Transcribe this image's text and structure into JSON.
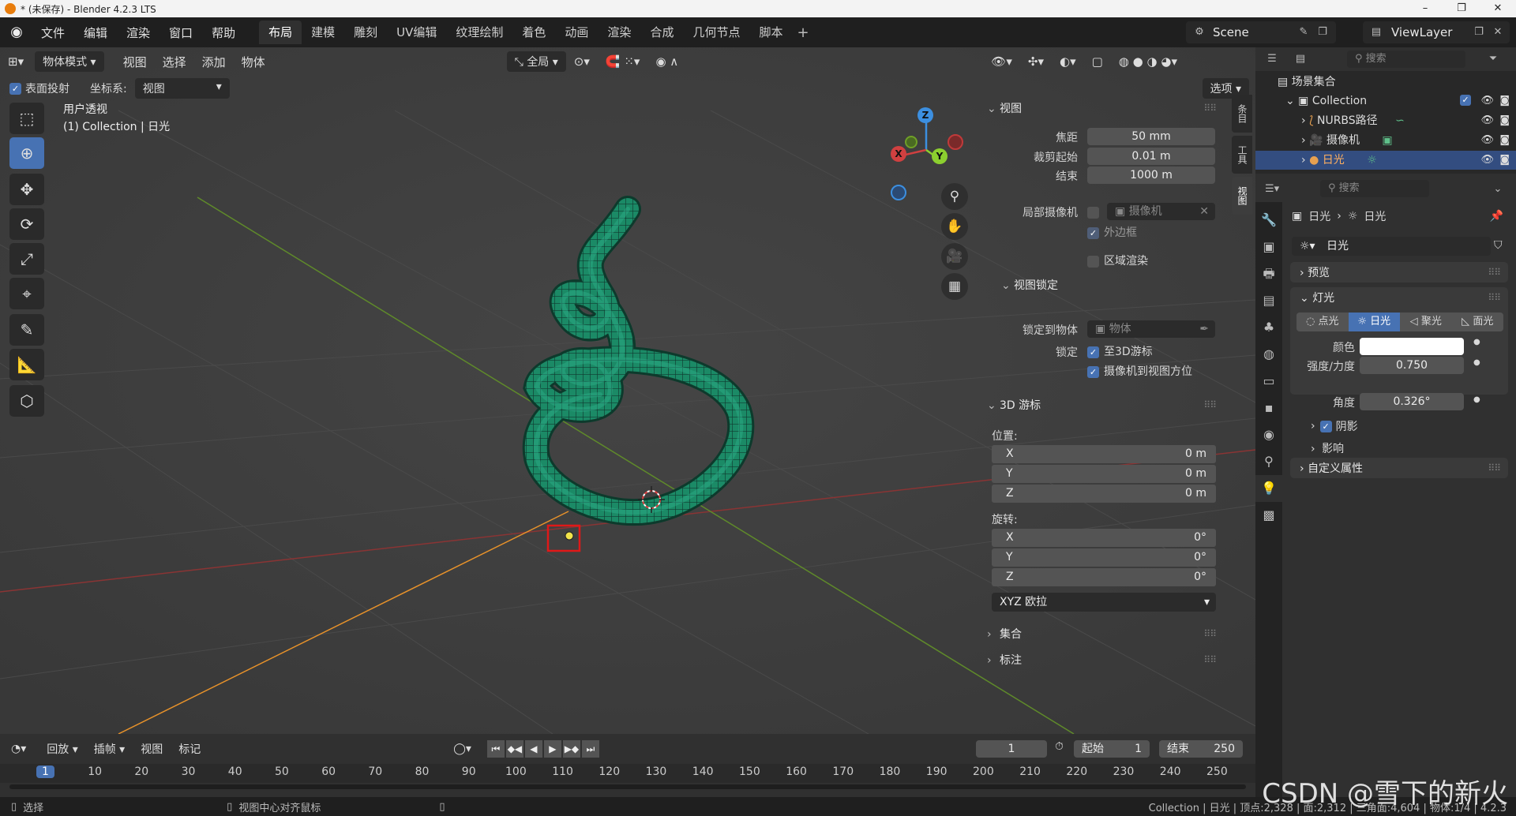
{
  "window": {
    "title": "* (未保存) - Blender 4.2.3 LTS",
    "min": "–",
    "max": "❐",
    "close": "✕"
  },
  "topbar": {
    "menus": [
      "文件",
      "编辑",
      "渲染",
      "窗口",
      "帮助"
    ],
    "tabs": [
      "布局",
      "建模",
      "雕刻",
      "UV编辑",
      "纹理绘制",
      "着色",
      "动画",
      "渲染",
      "合成",
      "几何节点",
      "脚本"
    ],
    "active_tab": 0,
    "scene": "Scene",
    "view_layer": "ViewLayer"
  },
  "viewport_header": {
    "mode": "物体模式",
    "menus": [
      "视图",
      "选择",
      "添加",
      "物体"
    ],
    "transform_orientation": "全局",
    "options": "选项",
    "surface_project_label": "表面投射",
    "coord_label": "坐标系:",
    "coord_value": "视图"
  },
  "viewport_info": {
    "line1": "用户透视",
    "line2": "(1) Collection | 日光"
  },
  "gizmo": {
    "x": "X",
    "y": "Y",
    "z": "Z"
  },
  "npanel": {
    "tabs": [
      "条目",
      "工具",
      "视图"
    ],
    "view_section": "视图",
    "focal_label": "焦距",
    "focal_value": "50 mm",
    "clip_start_label": "裁剪起始",
    "clip_start_value": "0.01 m",
    "clip_end_label": "结束",
    "clip_end_value": "1000 m",
    "local_camera_label": "局部摄像机",
    "local_camera_value": "摄像机",
    "border_label": "外边框",
    "region_render_label": "区域渲染",
    "view_lock_section": "视图锁定",
    "lock_to_object_label": "锁定到物体",
    "lock_to_object_value": "物体",
    "lock_label": "锁定",
    "lock_to_cursor": "至3D游标",
    "lock_camera_to_view": "摄像机到视图方位",
    "cursor_section": "3D 游标",
    "location_label": "位置:",
    "loc": [
      {
        "axis": "X",
        "value": "0 m"
      },
      {
        "axis": "Y",
        "value": "0 m"
      },
      {
        "axis": "Z",
        "value": "0 m"
      }
    ],
    "rotation_label": "旋转:",
    "rot": [
      {
        "axis": "X",
        "value": "0°"
      },
      {
        "axis": "Y",
        "value": "0°"
      },
      {
        "axis": "Z",
        "value": "0°"
      }
    ],
    "rotation_mode": "XYZ 欧拉",
    "collections_section": "集合",
    "annotations_section": "标注"
  },
  "outliner": {
    "search_placeholder": "搜索",
    "scene_collection": "场景集合",
    "collection": "Collection",
    "items": [
      "NURBS路径",
      "摄像机",
      "日光"
    ]
  },
  "properties": {
    "search_placeholder": "搜索",
    "breadcrumb_obj": "日光",
    "breadcrumb_data": "日光",
    "datablock": "日光",
    "preview": "预览",
    "light_section": "灯光",
    "light_types": [
      "点光",
      "日光",
      "聚光",
      "面光"
    ],
    "active_light_type": 1,
    "color_label": "颜色",
    "color_value": "#ffffff",
    "strength_label": "强度/力度",
    "strength_value": "0.750",
    "angle_label": "角度",
    "angle_value": "0.326°",
    "shadow": "阴影",
    "influence": "影响",
    "custom_props": "自定义属性"
  },
  "timeline": {
    "menus": [
      "回放",
      "插帧",
      "视图",
      "标记"
    ],
    "current_frame": "1",
    "start_label": "起始",
    "start_value": "1",
    "end_label": "结束",
    "end_value": "250",
    "ticks": [
      "1",
      "10",
      "20",
      "30",
      "40",
      "50",
      "60",
      "70",
      "80",
      "90",
      "100",
      "110",
      "120",
      "130",
      "140",
      "150",
      "160",
      "170",
      "180",
      "190",
      "200",
      "210",
      "220",
      "230",
      "240",
      "250"
    ]
  },
  "statusbar": {
    "select": "选择",
    "center_view": "视图中心对齐鼠标",
    "stats": "Collection | 日光 | 顶点:2,328 | 面:2,312 | 三角面:4,604 | 物体:1/4 | 4.2.3"
  },
  "watermark": "CSDN @雪下的新火",
  "colors": {
    "accent": "#4772b3",
    "selected_row": "#334d80",
    "curve": "#1f8c6a",
    "x_axis": "#d04040",
    "y_axis": "#8ccf2f",
    "z_axis": "#3c8fe0"
  }
}
